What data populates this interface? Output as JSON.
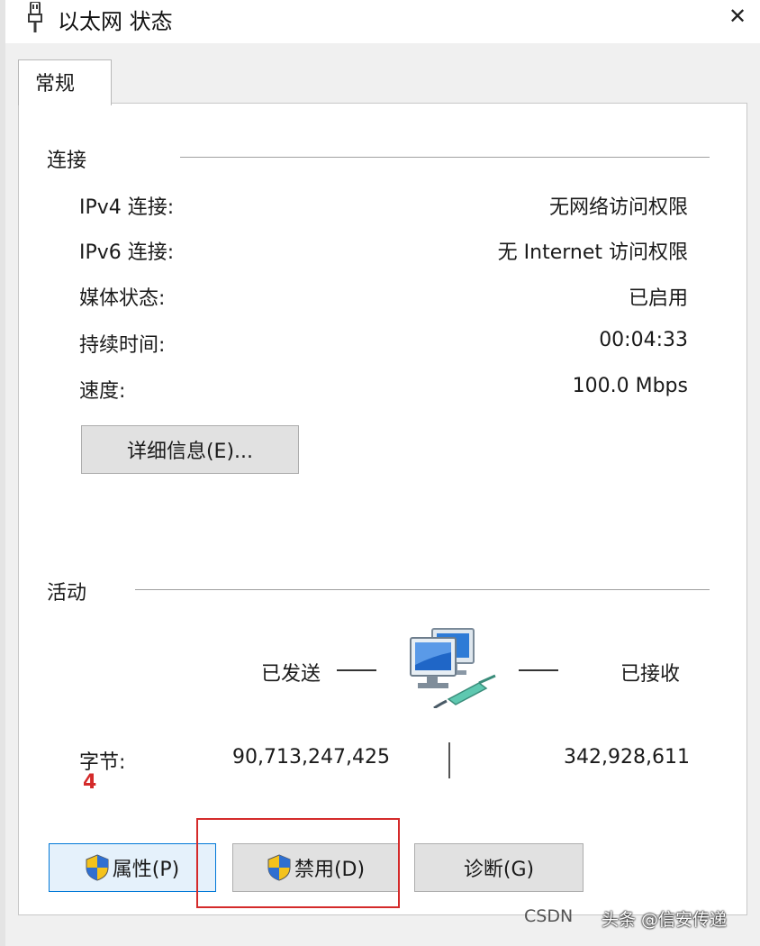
{
  "window": {
    "title": "以太网 状态",
    "close_glyph": "✕"
  },
  "tabs": [
    {
      "label": "常规"
    }
  ],
  "connection": {
    "heading": "连接",
    "rows": [
      {
        "label": "IPv4 连接:",
        "value": "无网络访问权限"
      },
      {
        "label": "IPv6 连接:",
        "value": "无 Internet 访问权限"
      },
      {
        "label": "媒体状态:",
        "value": "已启用"
      },
      {
        "label": "持续时间:",
        "value": "00:04:33"
      },
      {
        "label": "速度:",
        "value": "100.0 Mbps"
      }
    ],
    "details_button": "详细信息(E)..."
  },
  "activity": {
    "heading": "活动",
    "sent_label": "已发送",
    "received_label": "已接收",
    "bytes_label": "字节:",
    "bytes_sent": "90,713,247,425",
    "bytes_received": "342,928,611"
  },
  "buttons": {
    "properties": "属性(P)",
    "disable": "禁用(D)",
    "diagnose": "诊断(G)"
  },
  "annotation": {
    "step_number": "4",
    "color": "#d42a2a"
  },
  "watermark": {
    "csdn": "CSDN",
    "toutiao": "头条 @信安传递"
  },
  "icons": {
    "title": "ethernet-cable-icon",
    "network": "network-computers-icon",
    "shield": "uac-shield-icon"
  },
  "colors": {
    "focus_border": "#0078d7",
    "focus_bg": "#e5f1fb",
    "button_bg": "#e1e1e1"
  }
}
